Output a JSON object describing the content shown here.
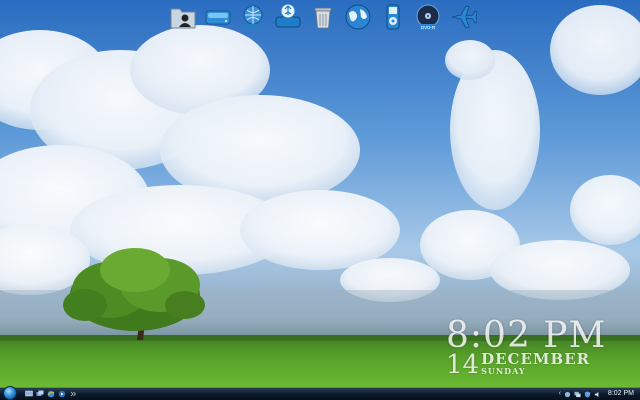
{
  "dock": {
    "items": [
      {
        "name": "user-folder-icon"
      },
      {
        "name": "hard-drive-icon"
      },
      {
        "name": "network-drive-icon"
      },
      {
        "name": "usb-drive-icon"
      },
      {
        "name": "recycle-bin-icon"
      },
      {
        "name": "internet-globe-icon"
      },
      {
        "name": "ipod-icon"
      },
      {
        "name": "dvd-drive-icon"
      },
      {
        "name": "airplane-icon"
      }
    ],
    "dvd_label": "DVD-R"
  },
  "clock_widget": {
    "time": "8:02 PM",
    "day": "14",
    "month": "DECEMBER",
    "weekday": "SUNDAY"
  },
  "taskbar": {
    "tray_time": "8:02 PM",
    "tray_expand": "‹"
  },
  "colors": {
    "sky_top": "#2f73c4",
    "grass": "#5fa82a",
    "taskbar": "#0d1a2a"
  }
}
